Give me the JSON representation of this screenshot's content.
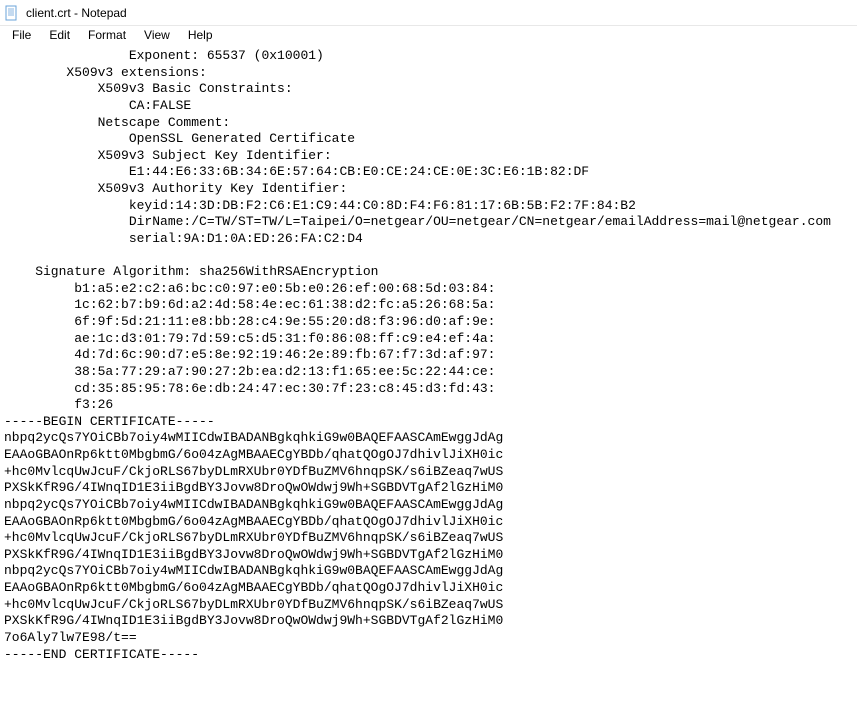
{
  "window": {
    "title": "client.crt - Notepad"
  },
  "menu": {
    "file": "File",
    "edit": "Edit",
    "format": "Format",
    "view": "View",
    "help": "Help"
  },
  "content": "                Exponent: 65537 (0x10001)\n        X509v3 extensions:\n            X509v3 Basic Constraints:\n                CA:FALSE\n            Netscape Comment:\n                OpenSSL Generated Certificate\n            X509v3 Subject Key Identifier:\n                E1:44:E6:33:6B:34:6E:57:64:CB:E0:CE:24:CE:0E:3C:E6:1B:82:DF\n            X509v3 Authority Key Identifier:\n                keyid:14:3D:DB:F2:C6:E1:C9:44:C0:8D:F4:F6:81:17:6B:5B:F2:7F:84:B2\n                DirName:/C=TW/ST=TW/L=Taipei/O=netgear/OU=netgear/CN=netgear/emailAddress=mail@netgear.com\n                serial:9A:D1:0A:ED:26:FA:C2:D4\n\n    Signature Algorithm: sha256WithRSAEncryption\n         b1:a5:e2:c2:a6:bc:c0:97:e0:5b:e0:26:ef:00:68:5d:03:84:\n         1c:62:b7:b9:6d:a2:4d:58:4e:ec:61:38:d2:fc:a5:26:68:5a:\n         6f:9f:5d:21:11:e8:bb:28:c4:9e:55:20:d8:f3:96:d0:af:9e:\n         ae:1c:d3:01:79:7d:59:c5:d5:31:f0:86:08:ff:c9:e4:ef:4a:\n         4d:7d:6c:90:d7:e5:8e:92:19:46:2e:89:fb:67:f7:3d:af:97:\n         38:5a:77:29:a7:90:27:2b:ea:d2:13:f1:65:ee:5c:22:44:ce:\n         cd:35:85:95:78:6e:db:24:47:ec:30:7f:23:c8:45:d3:fd:43:\n         f3:26\n-----BEGIN CERTIFICATE-----\nnbpq2ycQs7YOiCBb7oiy4wMIICdwIBADANBgkqhkiG9w0BAQEFAASCAmEwggJdAg\nEAAoGBAOnRp6ktt0MbgbmG/6o04zAgMBAAECgYBDb/qhatQOgOJ7dhivlJiXH0ic\n+hc0MvlcqUwJcuF/CkjoRLS67byDLmRXUbr0YDfBuZMV6hnqpSK/s6iBZeaq7wUS\nPXSkKfR9G/4IWnqID1E3iiBgdBY3Jovw8DroQwOWdwj9Wh+SGBDVTgAf2lGzHiM0\nnbpq2ycQs7YOiCBb7oiy4wMIICdwIBADANBgkqhkiG9w0BAQEFAASCAmEwggJdAg\nEAAoGBAOnRp6ktt0MbgbmG/6o04zAgMBAAECgYBDb/qhatQOgOJ7dhivlJiXH0ic\n+hc0MvlcqUwJcuF/CkjoRLS67byDLmRXUbr0YDfBuZMV6hnqpSK/s6iBZeaq7wUS\nPXSkKfR9G/4IWnqID1E3iiBgdBY3Jovw8DroQwOWdwj9Wh+SGBDVTgAf2lGzHiM0\nnbpq2ycQs7YOiCBb7oiy4wMIICdwIBADANBgkqhkiG9w0BAQEFAASCAmEwggJdAg\nEAAoGBAOnRp6ktt0MbgbmG/6o04zAgMBAAECgYBDb/qhatQOgOJ7dhivlJiXH0ic\n+hc0MvlcqUwJcuF/CkjoRLS67byDLmRXUbr0YDfBuZMV6hnqpSK/s6iBZeaq7wUS\nPXSkKfR9G/4IWnqID1E3iiBgdBY3Jovw8DroQwOWdwj9Wh+SGBDVTgAf2lGzHiM0\n7o6Aly7lw7E98/t==\n-----END CERTIFICATE-----"
}
